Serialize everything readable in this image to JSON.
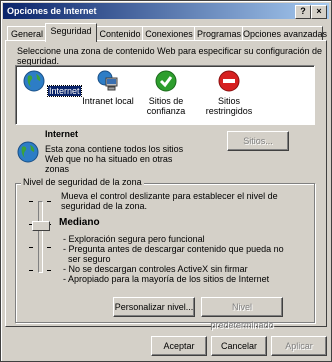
{
  "window": {
    "title": "Opciones de Internet"
  },
  "tabs": [
    {
      "label": "General"
    },
    {
      "label": "Seguridad"
    },
    {
      "label": "Contenido"
    },
    {
      "label": "Conexiones"
    },
    {
      "label": "Programas"
    },
    {
      "label": "Opciones avanzadas"
    }
  ],
  "instruction": [
    "Seleccione una zona de contenido Web para especificar su configuración de",
    "seguridad."
  ],
  "zones": [
    {
      "label": "Internet",
      "icon": "globe-icon"
    },
    {
      "label": "Intranet local",
      "icon": "computer-network-icon"
    },
    {
      "label": "Sitios de confianza",
      "icon": "check-icon"
    },
    {
      "label": "Sitios restringidos",
      "icon": "no-entry-icon"
    }
  ],
  "zone_info": {
    "title": "Internet",
    "description": [
      "Esta zona contiene todos los sitios",
      "Web que no ha situado en otras",
      "zonas"
    ],
    "sites_button": "Sitios..."
  },
  "security_level": {
    "group_label": "Nivel de seguridad de la zona",
    "hint": [
      "Mueva el control deslizante para establecer el nivel de",
      "seguridad de la zona."
    ],
    "level_name": "Mediano",
    "bullets": [
      "- Exploración segura pero funcional",
      "- Pregunta antes de descargar contenido que pueda no",
      "  ser seguro",
      "- No se descargan controles ActiveX sin firmar",
      "- Apropiado para la mayoría de los sitios de Internet"
    ],
    "custom_button": "Personalizar nivel...",
    "default_button": "Nivel predeterminado"
  },
  "footer": {
    "accept": "Aceptar",
    "cancel": "Cancelar",
    "apply": "Aplicar"
  },
  "title_buttons": {
    "help": "?",
    "close": "×"
  },
  "colors": {
    "titlebar": "#0a246a",
    "face": "#d4d0c8",
    "disabled": "#808080"
  }
}
